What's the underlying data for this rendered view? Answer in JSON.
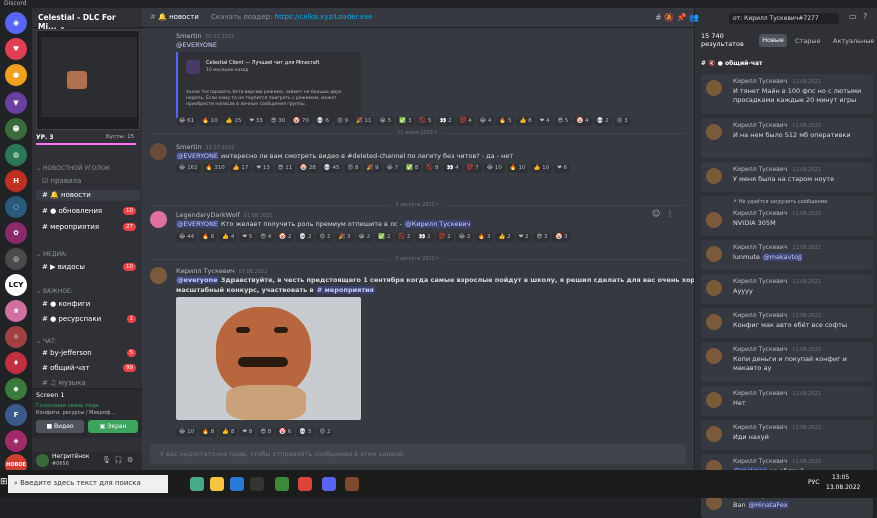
{
  "window": {
    "title": "Discord"
  },
  "server": {
    "name": "Celestial - DLC For Mi...",
    "boost": "УР. 3",
    "boosts": "Бусты: 15"
  },
  "categories": {
    "newcomers": "НОВОСТНОЙ УГОЛОК",
    "media": "МЕДИА",
    "important": "ВАЖНОЕ",
    "chat": "ЧАТ"
  },
  "channels": [
    {
      "name": "правила",
      "badge": ""
    },
    {
      "name": "новости",
      "badge": ""
    },
    {
      "name": "обновления",
      "badge": "10"
    },
    {
      "name": "мероприятия",
      "badge": "27"
    },
    {
      "name": "видосы",
      "badge": "10"
    },
    {
      "name": "конфиги",
      "badge": ""
    },
    {
      "name": "ресурспаки",
      "badge": "1"
    },
    {
      "name": "by-jefferson",
      "badge": "5"
    },
    {
      "name": "общий-чат",
      "badge": "99"
    },
    {
      "name": "музыка",
      "badge": ""
    }
  ],
  "screen_label": "Screen 1",
  "voice": {
    "status": "Голосовая связь подк",
    "sub": "Конфиги, ресурсы / Микроф...",
    "video": "Видео",
    "screen": "Экран"
  },
  "user": {
    "name": "Негритёнок",
    "tag": "#0656"
  },
  "topbar": {
    "channel": "новости",
    "loader_text": "Скачать лоадер:",
    "loader_link": "https://celka.xyz/Loader.exe"
  },
  "preview": {
    "title": "Celestial Client — Лучший чит для Minecraft",
    "sub": "10 месяцев назад"
  },
  "messages": [
    {
      "author": "Smertin",
      "time": "07.07.2022",
      "text": "@EVERYONE",
      "extra": "знали тестировать бета-версию режима, займет не больше двух недель. Если кому то не терпится поиграть с режимом, может приобрести написав в личные сообщения группы."
    },
    {
      "author": "Smertin",
      "time": "11.07.2022",
      "mention": "@EVERYONE",
      "text": "интересно ли вам смотреть видео в #deleted-channel по легиту без читов?  - да  - нет"
    },
    {
      "author": "LegendaryDarkWolf",
      "time": "01.08.2022",
      "mention": "@EVERYONE",
      "text": "Кто желает получить роль премиум отпишите в лс -",
      "tag": "@Кирилл Тускевич"
    },
    {
      "author": "Кирилл Тускевич",
      "time": "07.08.2022",
      "mention": "@everyone",
      "text": "Здравствуйте, в честь предстоящего 1 сентября когда самые взрослые пойдут в школу, я решил сделать для вас очень хороший и",
      "text2": "масштабный конкурс, участвовать в",
      "chan": "# мероприятия"
    }
  ],
  "reactions1": [
    "61",
    "10",
    "15",
    "33",
    "30",
    "70",
    "6",
    "9",
    "11",
    "5",
    "3",
    "5",
    "2",
    "4",
    "4",
    "5",
    "8",
    "4",
    "5",
    "4",
    "2",
    "3"
  ],
  "reactions2": [
    "162",
    "310",
    "17",
    "13",
    "11",
    "28",
    "45",
    "8",
    "9",
    "7",
    "8",
    "8",
    "4",
    "7",
    "10",
    "10",
    "10",
    "6"
  ],
  "reactions3": [
    "44",
    "6",
    "4",
    "5",
    "4",
    "2",
    "2",
    "2",
    "3",
    "2",
    "2",
    "2",
    "2",
    "2",
    "2",
    "3",
    "2",
    "2",
    "3",
    "3"
  ],
  "reactions4": [
    "10",
    "8",
    "8",
    "8",
    "8",
    "6",
    "5",
    "2"
  ],
  "dividers": [
    "11 июля 2022 г.",
    "1 августа 2022 г.",
    "7 августа 2022 г."
  ],
  "composer": {
    "placeholder": "У вас недостаточно прав, чтобы отправлять сообщения в этом канале."
  },
  "search": {
    "query": "от: Кирилл Тускевич#7277",
    "count": "15 740",
    "count_label": "результатов",
    "tabs": [
      "Новые",
      "Старые",
      "Актуальные"
    ],
    "channel": "общий-чат"
  },
  "results": [
    {
      "name": "Кирилл Тускевич",
      "time": "11.08.2022",
      "text": "И тянет Майн в 100 фпс но с лютыми просадками каждые 20 минут игры"
    },
    {
      "name": "Кирилл Тускевич",
      "time": "11.08.2022",
      "text": "И на нем было 512 мб оперативки"
    },
    {
      "name": "Кирилл Тускевич",
      "time": "11.08.2022",
      "text": "У меня была на старом ноуте"
    },
    {
      "name": "Кирилл Тускевич",
      "time": "11.08.2022",
      "text": "NVIDIA 305M",
      "note": "Не удаётся загрузить сообщение."
    },
    {
      "name": "Кирилл Тускевич",
      "time": "11.08.2022",
      "text": "lunmute",
      "mention": "@makavtoJJ"
    },
    {
      "name": "Кирилл Тускевич",
      "time": "11.08.2022",
      "text": "Ауууу"
    },
    {
      "name": "Кирилл Тускевич",
      "time": "11.08.2022",
      "text": "Конфиг мак авто ебёт все софты"
    },
    {
      "name": "Кирилл Тускевич",
      "time": "11.08.2022",
      "text": "Копи деньги и покупай конфиг и макавто ау"
    },
    {
      "name": "Кирилл Тускевич",
      "time": "11.08.2022",
      "text": "Нет"
    },
    {
      "name": "Кирилл Тускевич",
      "time": "11.08.2022",
      "text": "Иди нахуй"
    },
    {
      "name": "Кирилл Тускевич",
      "time": "11.08.2022",
      "mention": "@maknae",
      "text": "чо еблан?"
    },
    {
      "name": "Кирилл Тускевич",
      "time": "11.08.2022",
      "text": "Ban",
      "mention": "@HinataFex"
    }
  ],
  "taskbar": {
    "search": "Введите здесь текст для поиска",
    "lang": "РУС",
    "time": "13:05",
    "date": "13.08.2022"
  }
}
